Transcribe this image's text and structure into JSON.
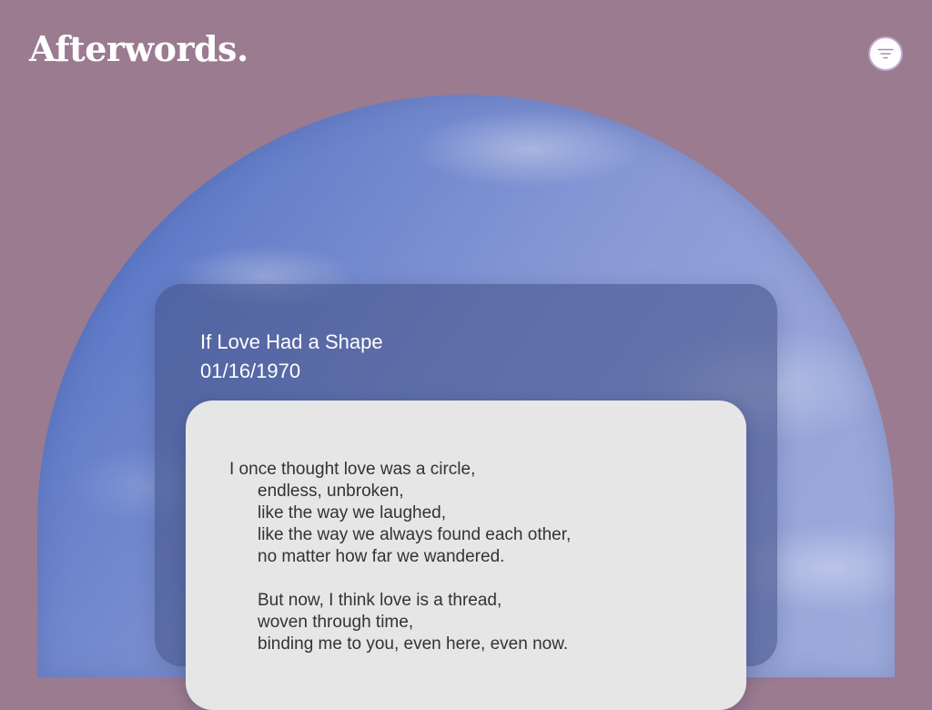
{
  "header": {
    "logo": "Afterwords.",
    "filter_icon": "filter-icon"
  },
  "poem": {
    "title": "If Love Had a Shape",
    "date": "01/16/1970",
    "lines": [
      {
        "text": "I once thought love was a circle,",
        "indent": false
      },
      {
        "text": "endless, unbroken,",
        "indent": true
      },
      {
        "text": "like the way we laughed,",
        "indent": true
      },
      {
        "text": "like the way we always found each other,",
        "indent": true
      },
      {
        "text": "no matter how far we wandered.",
        "indent": true
      },
      {
        "text": "",
        "indent": true
      },
      {
        "text": "But now, I think love is a thread,",
        "indent": true
      },
      {
        "text": "woven through time,",
        "indent": true
      },
      {
        "text": "binding me to you, even here, even now.",
        "indent": true
      }
    ]
  },
  "colors": {
    "background": "#9a7b90",
    "card_overlay": "#44548a",
    "poem_card": "#e6e6e6",
    "filter_border": "#c3a6d8"
  }
}
